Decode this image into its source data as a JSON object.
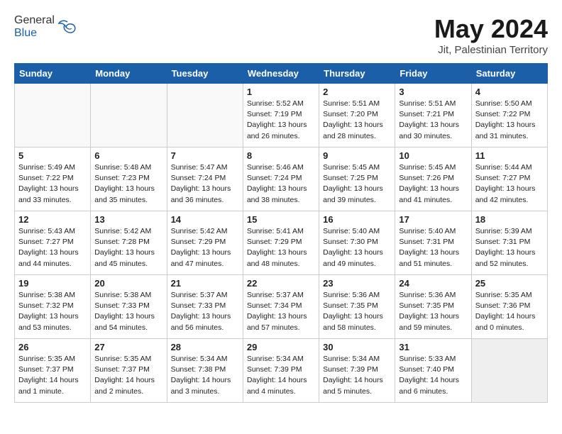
{
  "header": {
    "logo_general": "General",
    "logo_blue": "Blue",
    "month": "May 2024",
    "location": "Jit, Palestinian Territory"
  },
  "weekdays": [
    "Sunday",
    "Monday",
    "Tuesday",
    "Wednesday",
    "Thursday",
    "Friday",
    "Saturday"
  ],
  "weeks": [
    [
      {
        "day": "",
        "info": ""
      },
      {
        "day": "",
        "info": ""
      },
      {
        "day": "",
        "info": ""
      },
      {
        "day": "1",
        "info": "Sunrise: 5:52 AM\nSunset: 7:19 PM\nDaylight: 13 hours\nand 26 minutes."
      },
      {
        "day": "2",
        "info": "Sunrise: 5:51 AM\nSunset: 7:20 PM\nDaylight: 13 hours\nand 28 minutes."
      },
      {
        "day": "3",
        "info": "Sunrise: 5:51 AM\nSunset: 7:21 PM\nDaylight: 13 hours\nand 30 minutes."
      },
      {
        "day": "4",
        "info": "Sunrise: 5:50 AM\nSunset: 7:22 PM\nDaylight: 13 hours\nand 31 minutes."
      }
    ],
    [
      {
        "day": "5",
        "info": "Sunrise: 5:49 AM\nSunset: 7:22 PM\nDaylight: 13 hours\nand 33 minutes."
      },
      {
        "day": "6",
        "info": "Sunrise: 5:48 AM\nSunset: 7:23 PM\nDaylight: 13 hours\nand 35 minutes."
      },
      {
        "day": "7",
        "info": "Sunrise: 5:47 AM\nSunset: 7:24 PM\nDaylight: 13 hours\nand 36 minutes."
      },
      {
        "day": "8",
        "info": "Sunrise: 5:46 AM\nSunset: 7:24 PM\nDaylight: 13 hours\nand 38 minutes."
      },
      {
        "day": "9",
        "info": "Sunrise: 5:45 AM\nSunset: 7:25 PM\nDaylight: 13 hours\nand 39 minutes."
      },
      {
        "day": "10",
        "info": "Sunrise: 5:45 AM\nSunset: 7:26 PM\nDaylight: 13 hours\nand 41 minutes."
      },
      {
        "day": "11",
        "info": "Sunrise: 5:44 AM\nSunset: 7:27 PM\nDaylight: 13 hours\nand 42 minutes."
      }
    ],
    [
      {
        "day": "12",
        "info": "Sunrise: 5:43 AM\nSunset: 7:27 PM\nDaylight: 13 hours\nand 44 minutes."
      },
      {
        "day": "13",
        "info": "Sunrise: 5:42 AM\nSunset: 7:28 PM\nDaylight: 13 hours\nand 45 minutes."
      },
      {
        "day": "14",
        "info": "Sunrise: 5:42 AM\nSunset: 7:29 PM\nDaylight: 13 hours\nand 47 minutes."
      },
      {
        "day": "15",
        "info": "Sunrise: 5:41 AM\nSunset: 7:29 PM\nDaylight: 13 hours\nand 48 minutes."
      },
      {
        "day": "16",
        "info": "Sunrise: 5:40 AM\nSunset: 7:30 PM\nDaylight: 13 hours\nand 49 minutes."
      },
      {
        "day": "17",
        "info": "Sunrise: 5:40 AM\nSunset: 7:31 PM\nDaylight: 13 hours\nand 51 minutes."
      },
      {
        "day": "18",
        "info": "Sunrise: 5:39 AM\nSunset: 7:31 PM\nDaylight: 13 hours\nand 52 minutes."
      }
    ],
    [
      {
        "day": "19",
        "info": "Sunrise: 5:38 AM\nSunset: 7:32 PM\nDaylight: 13 hours\nand 53 minutes."
      },
      {
        "day": "20",
        "info": "Sunrise: 5:38 AM\nSunset: 7:33 PM\nDaylight: 13 hours\nand 54 minutes."
      },
      {
        "day": "21",
        "info": "Sunrise: 5:37 AM\nSunset: 7:33 PM\nDaylight: 13 hours\nand 56 minutes."
      },
      {
        "day": "22",
        "info": "Sunrise: 5:37 AM\nSunset: 7:34 PM\nDaylight: 13 hours\nand 57 minutes."
      },
      {
        "day": "23",
        "info": "Sunrise: 5:36 AM\nSunset: 7:35 PM\nDaylight: 13 hours\nand 58 minutes."
      },
      {
        "day": "24",
        "info": "Sunrise: 5:36 AM\nSunset: 7:35 PM\nDaylight: 13 hours\nand 59 minutes."
      },
      {
        "day": "25",
        "info": "Sunrise: 5:35 AM\nSunset: 7:36 PM\nDaylight: 14 hours\nand 0 minutes."
      }
    ],
    [
      {
        "day": "26",
        "info": "Sunrise: 5:35 AM\nSunset: 7:37 PM\nDaylight: 14 hours\nand 1 minute."
      },
      {
        "day": "27",
        "info": "Sunrise: 5:35 AM\nSunset: 7:37 PM\nDaylight: 14 hours\nand 2 minutes."
      },
      {
        "day": "28",
        "info": "Sunrise: 5:34 AM\nSunset: 7:38 PM\nDaylight: 14 hours\nand 3 minutes."
      },
      {
        "day": "29",
        "info": "Sunrise: 5:34 AM\nSunset: 7:39 PM\nDaylight: 14 hours\nand 4 minutes."
      },
      {
        "day": "30",
        "info": "Sunrise: 5:34 AM\nSunset: 7:39 PM\nDaylight: 14 hours\nand 5 minutes."
      },
      {
        "day": "31",
        "info": "Sunrise: 5:33 AM\nSunset: 7:40 PM\nDaylight: 14 hours\nand 6 minutes."
      },
      {
        "day": "",
        "info": ""
      }
    ]
  ]
}
